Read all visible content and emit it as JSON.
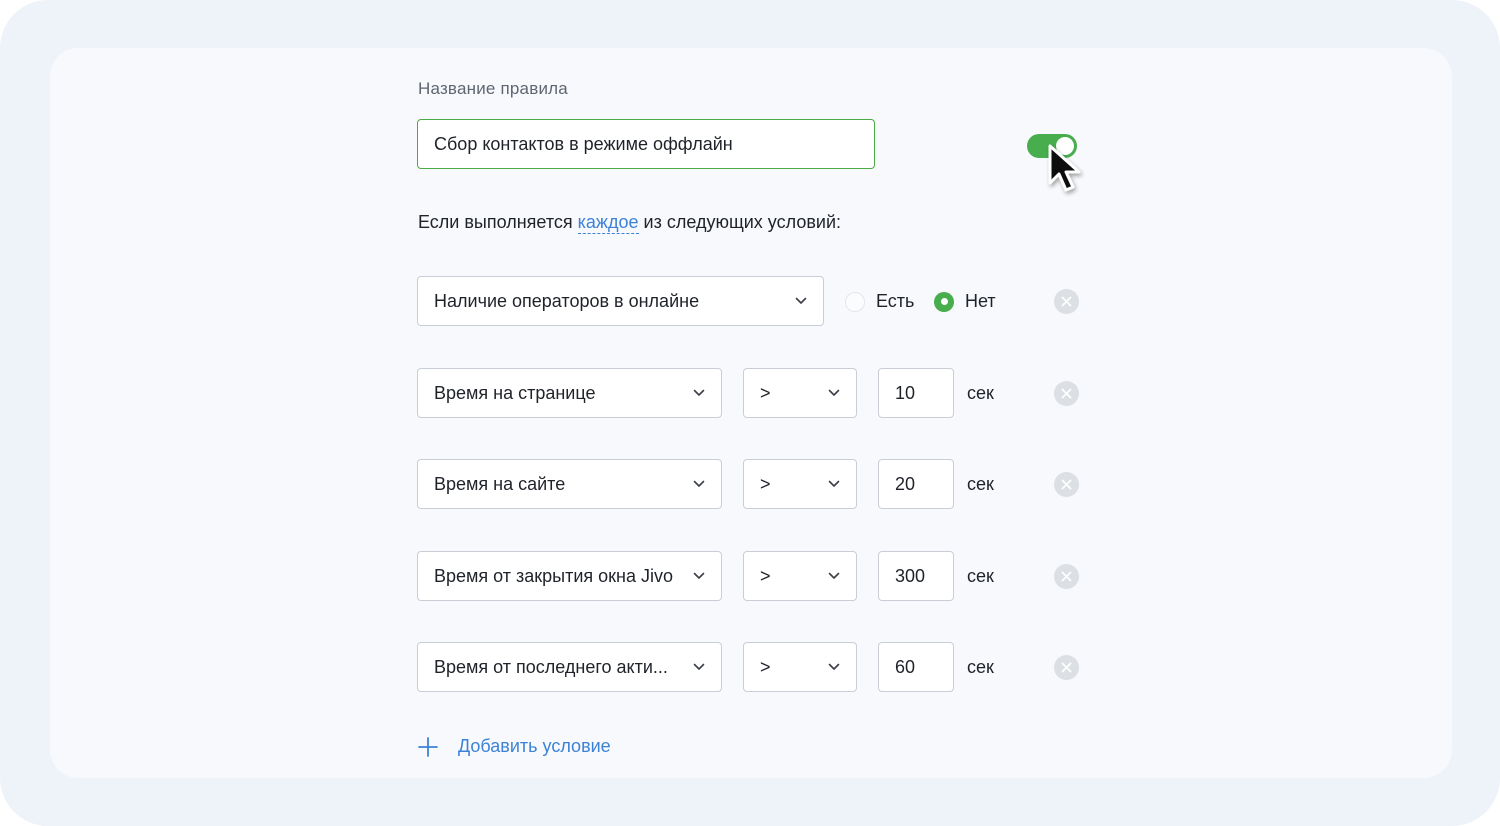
{
  "form": {
    "rule_name_label": "Название правила",
    "rule_name_value": "Сбор контактов в режиме оффлайн",
    "enabled": true,
    "conditions_prefix": "Если выполняется",
    "conditions_mode": "каждое",
    "conditions_suffix": "из следующих условий:"
  },
  "operators_condition": {
    "field": "Наличие операторов в онлайне",
    "options": [
      "Есть",
      "Нет"
    ],
    "selected": "Нет"
  },
  "conditions": [
    {
      "field": "Время на странице",
      "operator": ">",
      "value": "10",
      "unit": "сек"
    },
    {
      "field": "Время на сайте",
      "operator": ">",
      "value": "20",
      "unit": "сек"
    },
    {
      "field": "Время от закрытия окна Jivo",
      "operator": ">",
      "value": "300",
      "unit": "сек"
    },
    {
      "field": "Время от последнего акти...",
      "operator": ">",
      "value": "60",
      "unit": "сек"
    }
  ],
  "add_condition_label": "Добавить условие",
  "colors": {
    "accent_green": "#47ad4d",
    "link_blue": "#3d82d6",
    "background": "#eef3f9",
    "card": "#f7f9fc"
  },
  "icons": [
    "chevron-down-icon",
    "close-icon",
    "plus-icon",
    "cursor-icon"
  ]
}
